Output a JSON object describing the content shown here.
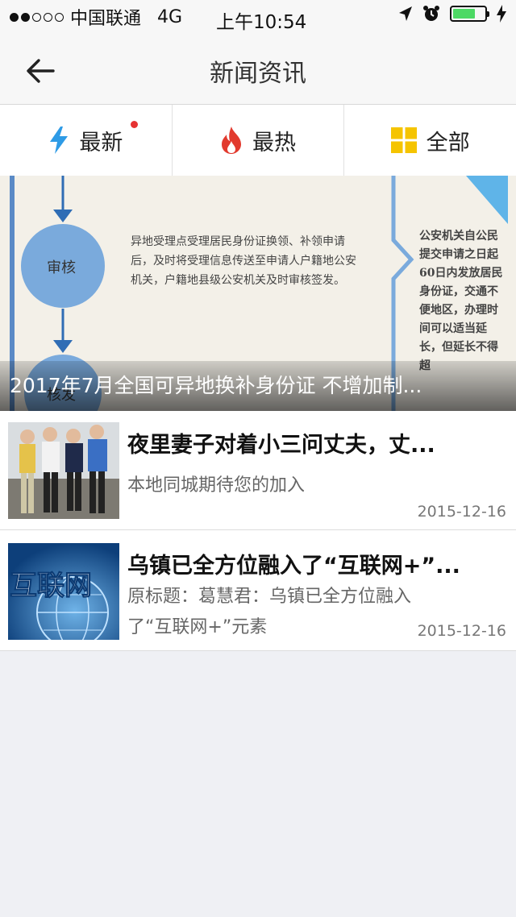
{
  "status": {
    "carrier": "中国联通",
    "network": "4G",
    "time": "上午10:54"
  },
  "nav": {
    "title": "新闻资讯"
  },
  "tabs": [
    {
      "label": "最新",
      "icon": "lightning-icon",
      "has_dot": true
    },
    {
      "label": "最热",
      "icon": "flame-icon"
    },
    {
      "label": "全部",
      "icon": "grid-icon"
    }
  ],
  "banner": {
    "caption": "2017年7月全国可异地换补身份证 不增加制...",
    "image_text": {
      "node1": "审核",
      "node2": "核发",
      "middle": "异地受理点受理居民身份证换领、补领申请后，及时将受理信息传送至申请人户籍地公安机关，户籍地县级公安机关及时审核签发。",
      "right": "公安机关自公民提交申请之日起60日内发放居民身份证，交通不便地区，办理时间可以适当延长，但延长不得超"
    }
  },
  "news": [
    {
      "title": "夜里妻子对着小三问丈夫，丈...",
      "desc": "本地同城期待您的加入",
      "date": "2015-12-16"
    },
    {
      "title": "乌镇已全方位融入了“互联网+”...",
      "desc": "原标题：葛慧君：乌镇已全方位融入了“互联网+”元素",
      "date": "2015-12-16",
      "thumb_text": "互联网"
    }
  ],
  "colors": {
    "accent_blue": "#2e9be6",
    "flame_red": "#e23a2e",
    "grid_yellow": "#f5c400",
    "red_dot": "#e63232"
  }
}
